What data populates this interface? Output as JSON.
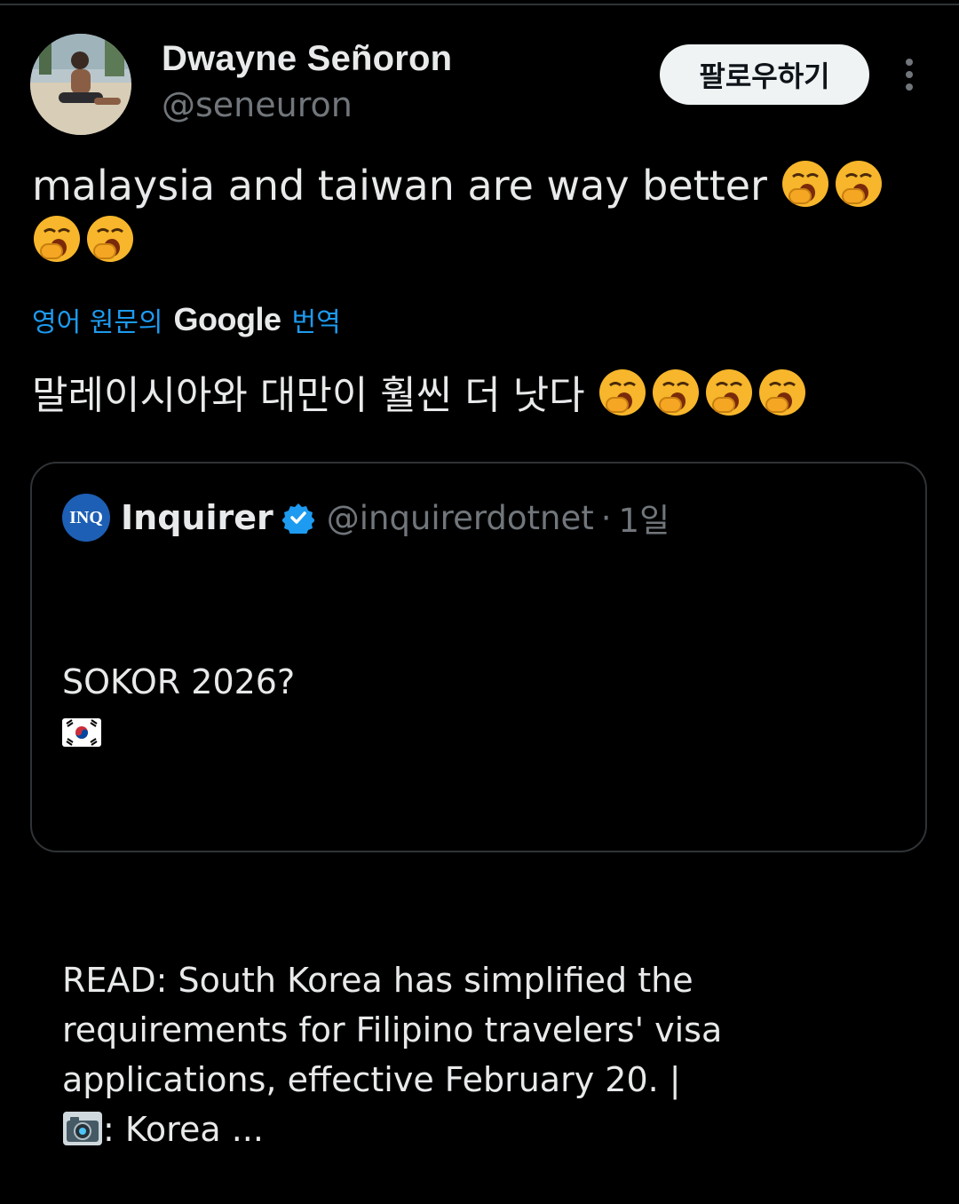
{
  "author": {
    "name": "Dwayne Señoron",
    "handle": "@seneuron"
  },
  "follow_button": "팔로우하기",
  "tweet": {
    "text": "malaysia and taiwan are way better",
    "emoji": "yawning-face",
    "emoji_count": 4
  },
  "translation": {
    "prefix": "영어 원문의",
    "provider": "Google",
    "suffix": "번역",
    "text": "말레이시아와 대만이 훨씬 더 낫다"
  },
  "quote": {
    "avatar_text": "INQ",
    "name": "Inquirer",
    "handle": "@inquirerdotnet",
    "separator": "·",
    "time": "1일",
    "line1": "SOKOR 2026?",
    "line2": "READ: South Korea has simplified the requirements for Filipino travelers' visa applications, effective February 20. |",
    "line3": ": Korea ..."
  },
  "colors": {
    "background": "#000000",
    "text": "#e7e9ea",
    "muted": "#71767b",
    "link": "#1d9bf0",
    "border": "#2f3336",
    "button_bg": "#eff3f4",
    "inquirer_blue": "#1d5fb4"
  }
}
